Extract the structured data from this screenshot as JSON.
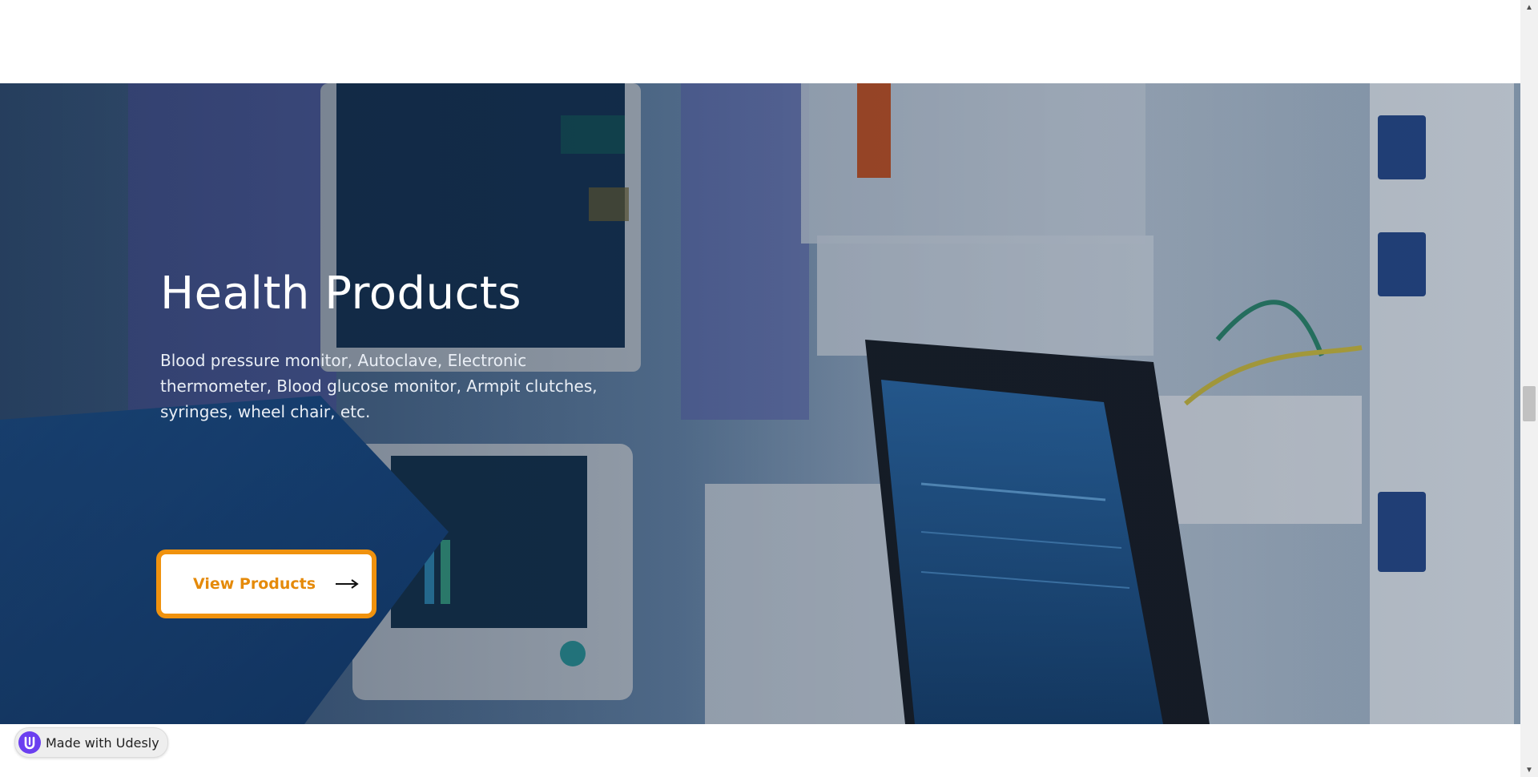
{
  "hero": {
    "title": "Health Products",
    "description": "Blood pressure monitor, Autoclave, Electronic thermometer, Blood glucose monitor, Armpit clutches, syringes, wheel chair, etc.",
    "cta_label": "View Products",
    "cta_icon": "arrow-right-icon",
    "background_image": "medical-equipment-photo"
  },
  "badge": {
    "text": "Made with Udesly",
    "logo": "udesly-logo"
  },
  "colors": {
    "accent": "#f0920e",
    "cta_text": "#e58a0a",
    "badge_logo": "#6b3ff0",
    "overlay": "#14233c"
  }
}
